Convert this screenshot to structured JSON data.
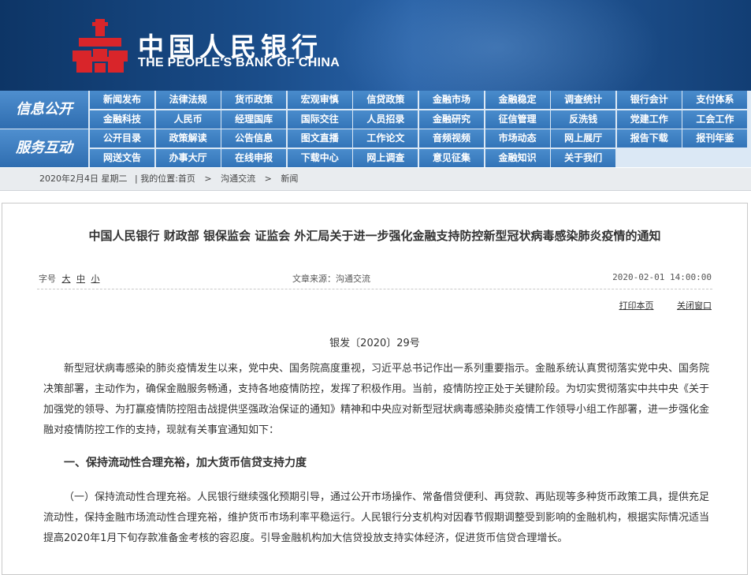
{
  "header": {
    "brand_cn": "中国人民银行",
    "brand_en": "THE PEOPLE'S BANK OF CHINA",
    "logo_icon": "pboc-logo-icon",
    "logo_color": "#d9252a"
  },
  "nav": {
    "section1_label": "信息公开",
    "section2_label": "服务互动",
    "section1_row1": [
      "新闻发布",
      "法律法规",
      "货币政策",
      "宏观审慎",
      "信贷政策",
      "金融市场",
      "金融稳定",
      "调查统计",
      "银行会计",
      "支付体系"
    ],
    "section1_row2": [
      "金融科技",
      "人民币",
      "经理国库",
      "国际交往",
      "人员招录",
      "金融研究",
      "征信管理",
      "反洗钱",
      "党建工作",
      "工会工作"
    ],
    "section2_row1": [
      "公开目录",
      "政策解读",
      "公告信息",
      "图文直播",
      "工作论文",
      "音频视频",
      "市场动态",
      "网上展厅",
      "报告下载",
      "报刊年鉴"
    ],
    "section2_row2": [
      "网送文告",
      "办事大厅",
      "在线申报",
      "下载中心",
      "网上调查",
      "意见征集",
      "金融知识",
      "关于我们"
    ]
  },
  "breadcrumb": {
    "date": "2020年2月4日  星期二",
    "prefix": "|  我的位置:",
    "home": "首页",
    "sep1": ">",
    "level2": "沟通交流",
    "sep2": ">",
    "level3": "新闻"
  },
  "article": {
    "title": "中国人民银行  财政部  银保监会  证监会  外汇局关于进一步强化金融支持防控新型冠状病毒感染肺炎疫情的通知",
    "font_label": "字号",
    "font_large": "大",
    "font_medium": "中",
    "font_small": "小",
    "source": "文章来源：沟通交流",
    "time": "2020-02-01 14:00:00",
    "print_link": "打印本页",
    "close_link": "关闭窗口",
    "doc_no": "银发〔2020〕29号",
    "para1": "新型冠状病毒感染的肺炎疫情发生以来，党中央、国务院高度重视，习近平总书记作出一系列重要指示。金融系统认真贯彻落实党中央、国务院决策部署，主动作为，确保金融服务畅通，支持各地疫情防控，发挥了积极作用。当前，疫情防控正处于关键阶段。为切实贯彻落实中共中央《关于加强党的领导、为打赢疫情防控阻击战提供坚强政治保证的通知》精神和中央应对新型冠状病毒感染肺炎疫情工作领导小组工作部署，进一步强化金融对疫情防控工作的支持，现就有关事宜通知如下：",
    "heading1": "一、保持流动性合理充裕，加大货币信贷支持力度",
    "para2": "（一）保持流动性合理充裕。人民银行继续强化预期引导，通过公开市场操作、常备借贷便利、再贷款、再贴现等多种货币政策工具，提供充足流动性，保持金融市场流动性合理充裕，维护货币市场利率平稳运行。人民银行分支机构对因春节假期调整受到影响的金融机构，根据实际情况适当提高2020年1月下旬存款准备金考核的容忍度。引导金融机构加大信贷投放支持实体经济，促进货币信贷合理增长。"
  }
}
